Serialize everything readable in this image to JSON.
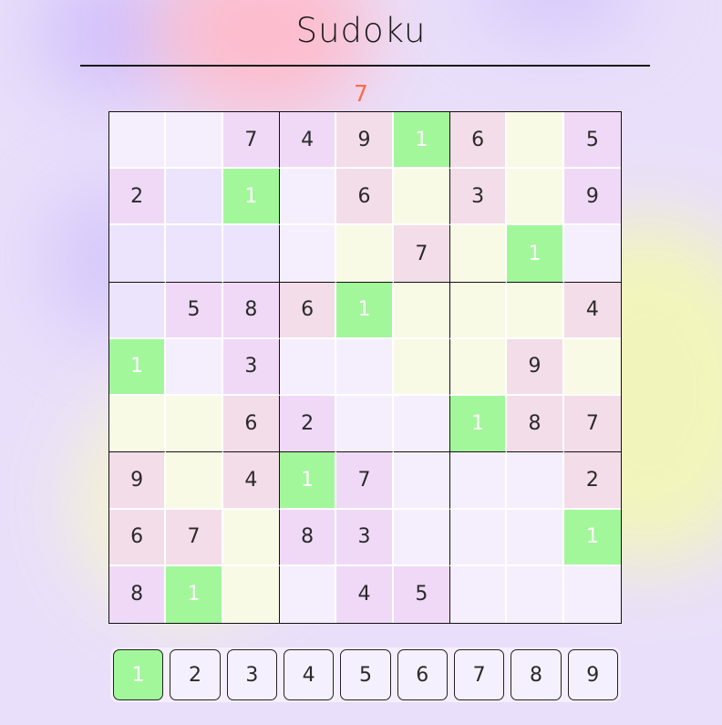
{
  "title": "Sudoku",
  "selected_count": "7",
  "colors": {
    "highlight_green": "#a3f79b",
    "counter_red": "#ff6a4a",
    "cell_palette": {
      "pink": "#f3dde8",
      "lilac": "#f0d9f7",
      "lavender": "#ebe4fc",
      "pale": "#f5effd",
      "yellow": "#f9fae6",
      "green": "#a3f79b"
    }
  },
  "board": [
    [
      {
        "v": "",
        "c": "pale"
      },
      {
        "v": "",
        "c": "pale"
      },
      {
        "v": "7",
        "c": "lilac"
      },
      {
        "v": "4",
        "c": "lilac"
      },
      {
        "v": "9",
        "c": "pink"
      },
      {
        "v": "1",
        "c": "green"
      },
      {
        "v": "6",
        "c": "pink"
      },
      {
        "v": "",
        "c": "yellow"
      },
      {
        "v": "5",
        "c": "lilac"
      }
    ],
    [
      {
        "v": "2",
        "c": "lilac"
      },
      {
        "v": "",
        "c": "lavender"
      },
      {
        "v": "1",
        "c": "green"
      },
      {
        "v": "",
        "c": "pale"
      },
      {
        "v": "6",
        "c": "pink"
      },
      {
        "v": "",
        "c": "yellow"
      },
      {
        "v": "3",
        "c": "pink"
      },
      {
        "v": "",
        "c": "yellow"
      },
      {
        "v": "9",
        "c": "lilac"
      }
    ],
    [
      {
        "v": "",
        "c": "lavender"
      },
      {
        "v": "",
        "c": "lavender"
      },
      {
        "v": "",
        "c": "lavender"
      },
      {
        "v": "",
        "c": "pale"
      },
      {
        "v": "",
        "c": "yellow"
      },
      {
        "v": "7",
        "c": "pink"
      },
      {
        "v": "",
        "c": "yellow"
      },
      {
        "v": "1",
        "c": "green"
      },
      {
        "v": "",
        "c": "pale"
      }
    ],
    [
      {
        "v": "",
        "c": "lavender"
      },
      {
        "v": "5",
        "c": "lilac"
      },
      {
        "v": "8",
        "c": "lilac"
      },
      {
        "v": "6",
        "c": "pink"
      },
      {
        "v": "1",
        "c": "green"
      },
      {
        "v": "",
        "c": "yellow"
      },
      {
        "v": "",
        "c": "yellow"
      },
      {
        "v": "",
        "c": "yellow"
      },
      {
        "v": "4",
        "c": "pink"
      }
    ],
    [
      {
        "v": "1",
        "c": "green"
      },
      {
        "v": "",
        "c": "pale"
      },
      {
        "v": "3",
        "c": "lilac"
      },
      {
        "v": "",
        "c": "pale"
      },
      {
        "v": "",
        "c": "pale"
      },
      {
        "v": "",
        "c": "yellow"
      },
      {
        "v": "",
        "c": "yellow"
      },
      {
        "v": "9",
        "c": "pink"
      },
      {
        "v": "",
        "c": "yellow"
      }
    ],
    [
      {
        "v": "",
        "c": "yellow"
      },
      {
        "v": "",
        "c": "yellow"
      },
      {
        "v": "6",
        "c": "pink"
      },
      {
        "v": "2",
        "c": "lilac"
      },
      {
        "v": "",
        "c": "pale"
      },
      {
        "v": "",
        "c": "pale"
      },
      {
        "v": "1",
        "c": "green"
      },
      {
        "v": "8",
        "c": "pink"
      },
      {
        "v": "7",
        "c": "pink"
      }
    ],
    [
      {
        "v": "9",
        "c": "pink"
      },
      {
        "v": "",
        "c": "yellow"
      },
      {
        "v": "4",
        "c": "pink"
      },
      {
        "v": "1",
        "c": "green"
      },
      {
        "v": "7",
        "c": "lilac"
      },
      {
        "v": "",
        "c": "pale"
      },
      {
        "v": "",
        "c": "pale"
      },
      {
        "v": "",
        "c": "pale"
      },
      {
        "v": "2",
        "c": "pink"
      }
    ],
    [
      {
        "v": "6",
        "c": "pink"
      },
      {
        "v": "7",
        "c": "pink"
      },
      {
        "v": "",
        "c": "yellow"
      },
      {
        "v": "8",
        "c": "lilac"
      },
      {
        "v": "3",
        "c": "lilac"
      },
      {
        "v": "",
        "c": "pale"
      },
      {
        "v": "",
        "c": "pale"
      },
      {
        "v": "",
        "c": "pale"
      },
      {
        "v": "1",
        "c": "green"
      }
    ],
    [
      {
        "v": "8",
        "c": "lilac"
      },
      {
        "v": "1",
        "c": "green"
      },
      {
        "v": "",
        "c": "yellow"
      },
      {
        "v": "",
        "c": "pale"
      },
      {
        "v": "4",
        "c": "lilac"
      },
      {
        "v": "5",
        "c": "lilac"
      },
      {
        "v": "",
        "c": "pale"
      },
      {
        "v": "",
        "c": "pale"
      },
      {
        "v": "",
        "c": "pale"
      }
    ]
  ],
  "numpad": {
    "selected": "1",
    "buttons": [
      "1",
      "2",
      "3",
      "4",
      "5",
      "6",
      "7",
      "8",
      "9"
    ]
  }
}
